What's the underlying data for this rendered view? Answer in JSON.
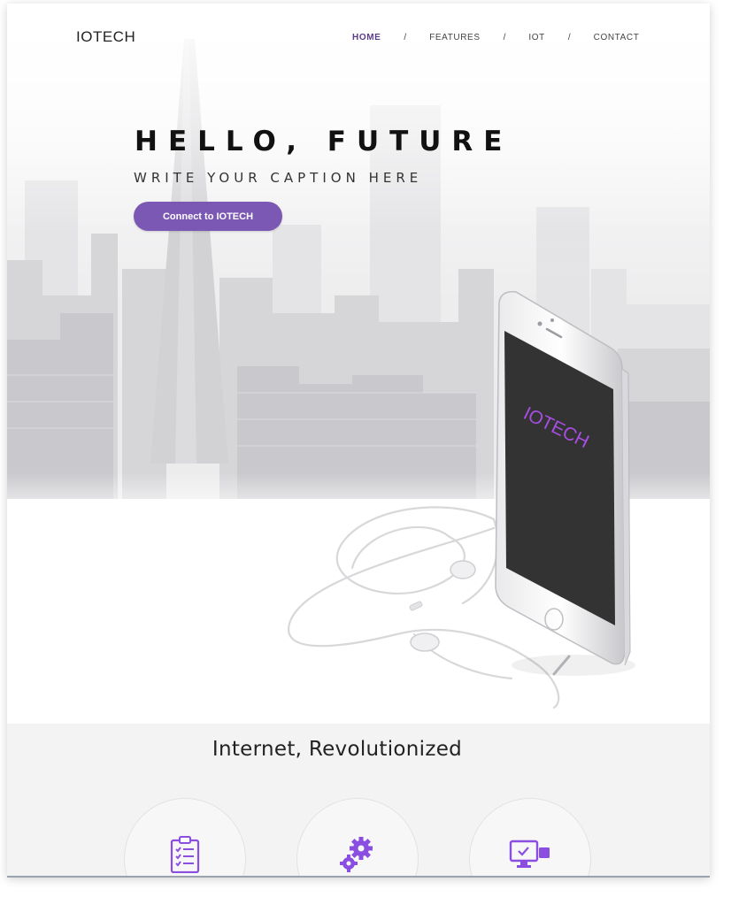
{
  "brand": {
    "logo": "IOTECH"
  },
  "nav": {
    "items": [
      {
        "label": "HOME",
        "active": true
      },
      {
        "label": "FEATURES",
        "active": false
      },
      {
        "label": "IOT",
        "active": false
      },
      {
        "label": "CONTACT",
        "active": false
      }
    ],
    "separator": "/"
  },
  "hero": {
    "title": "HELLO, FUTURE",
    "caption": "WRITE YOUR CAPTION HERE",
    "cta_label": "Connect to IOTECH",
    "phone_screen_text": "IOTECH"
  },
  "features": {
    "title": "Internet, Revolutionized",
    "items": [
      {
        "icon": "clipboard-checklist-icon"
      },
      {
        "icon": "gears-icon"
      },
      {
        "icon": "monitor-device-icon"
      }
    ]
  },
  "colors": {
    "accent": "#7b58b3",
    "nav_active": "#5a3c8c",
    "icon_purple": "#8a4fe0",
    "phone_screen": "#333333",
    "phone_text": "#a64ee0"
  }
}
